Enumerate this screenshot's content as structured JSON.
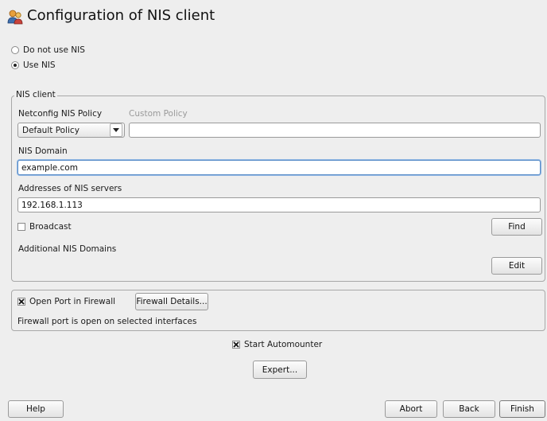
{
  "header": {
    "title": "Configuration of NIS client",
    "icon": "nis-client-icon"
  },
  "mode": {
    "options": [
      {
        "label": "Do not use NIS",
        "checked": false
      },
      {
        "label": "Use NIS",
        "checked": true
      }
    ]
  },
  "nis_client": {
    "group_title": "NIS client",
    "policy_label": "Netconfig NIS Policy",
    "policy_value": "Default Policy",
    "custom_policy_label": "Custom Policy",
    "custom_policy_value": "",
    "domain_label": "NIS Domain",
    "domain_value": "example.com",
    "servers_label": "Addresses of NIS servers",
    "servers_value": "192.168.1.113",
    "broadcast_label": "Broadcast",
    "broadcast_checked": false,
    "find_label": "Find",
    "additional_label": "Additional NIS Domains",
    "edit_label": "Edit"
  },
  "firewall": {
    "open_port_label": "Open Port in Firewall",
    "open_port_checked": true,
    "details_label": "Firewall Details...",
    "status_text": "Firewall port is open on selected interfaces"
  },
  "automounter": {
    "label": "Start Automounter",
    "checked": true
  },
  "expert_label": "Expert...",
  "footer": {
    "help_label": "Help",
    "abort_label": "Abort",
    "back_label": "Back",
    "finish_label": "Finish"
  },
  "colors": {
    "background": "#eeeeee",
    "focus": "#5d8fc9"
  }
}
